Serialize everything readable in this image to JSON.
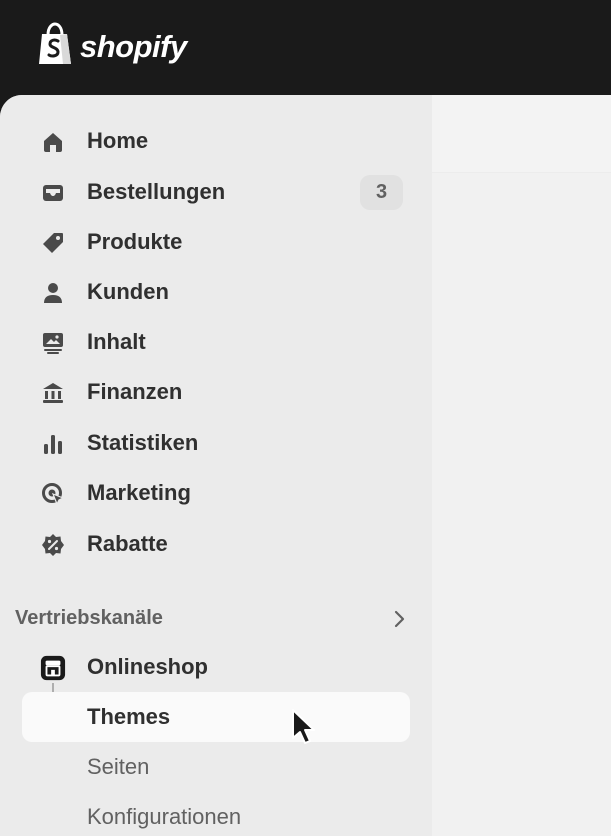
{
  "brand": {
    "name": "shopify",
    "logo_icon": "shopify-bag-icon",
    "text_color": "#ffffff"
  },
  "colors": {
    "topbar_bg": "#1a1a1a",
    "sidebar_bg": "#ebebeb",
    "main_bg": "#f1f1f1",
    "selected_bg": "#fafafa",
    "text_primary": "#303030",
    "text_secondary": "#616161",
    "badge_bg": "#e1e1e1"
  },
  "sidebar": {
    "items": [
      {
        "label": "Home",
        "icon": "home-icon"
      },
      {
        "label": "Bestellungen",
        "icon": "inbox-icon",
        "badge": "3"
      },
      {
        "label": "Produkte",
        "icon": "tag-icon"
      },
      {
        "label": "Kunden",
        "icon": "person-icon"
      },
      {
        "label": "Inhalt",
        "icon": "content-icon"
      },
      {
        "label": "Finanzen",
        "icon": "bank-icon"
      },
      {
        "label": "Statistiken",
        "icon": "bar-chart-icon"
      },
      {
        "label": "Marketing",
        "icon": "target-icon"
      },
      {
        "label": "Rabatte",
        "icon": "discount-icon"
      }
    ],
    "sales_channels": {
      "heading": "Vertriebskanäle",
      "icon": "chevron-right-icon",
      "channel": {
        "label": "Onlineshop",
        "icon": "storefront-icon",
        "subitems": [
          {
            "label": "Themes",
            "selected": true
          },
          {
            "label": "Seiten",
            "selected": false
          },
          {
            "label": "Konfigurationen",
            "selected": false
          }
        ]
      }
    }
  }
}
